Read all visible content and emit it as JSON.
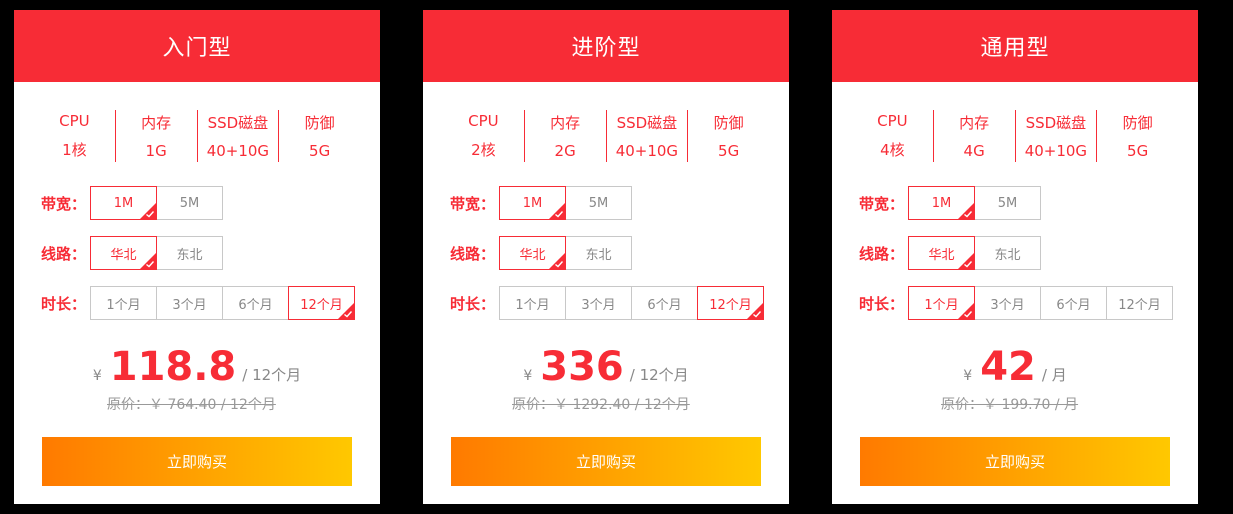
{
  "theme": {
    "accent": "#f72c36",
    "gradient_start": "#ff7a00",
    "gradient_end": "#ffc800"
  },
  "labels": {
    "bandwidth": "带宽：",
    "route": "线路：",
    "duration": "时长："
  },
  "plans": [
    {
      "title": "入门型",
      "specs": [
        {
          "name": "CPU",
          "value": "1核"
        },
        {
          "name": "内存",
          "value": "1G"
        },
        {
          "name": "SSD磁盘",
          "value": "40+10G"
        },
        {
          "name": "防御",
          "value": "5G"
        }
      ],
      "bandwidth": [
        {
          "label": "1M",
          "selected": true
        },
        {
          "label": "5M",
          "selected": false
        }
      ],
      "route": [
        {
          "label": "华北",
          "selected": true
        },
        {
          "label": "东北",
          "selected": false
        }
      ],
      "duration": [
        {
          "label": "1个月",
          "selected": false
        },
        {
          "label": "3个月",
          "selected": false
        },
        {
          "label": "6个月",
          "selected": false
        },
        {
          "label": "12个月",
          "selected": true
        }
      ],
      "currency": "¥",
      "price": "118.8",
      "period": "/ 12个月",
      "original": "原价：￥ 764.40 / 12个月",
      "buy_label": "立即购买"
    },
    {
      "title": "进阶型",
      "specs": [
        {
          "name": "CPU",
          "value": "2核"
        },
        {
          "name": "内存",
          "value": "2G"
        },
        {
          "name": "SSD磁盘",
          "value": "40+10G"
        },
        {
          "name": "防御",
          "value": "5G"
        }
      ],
      "bandwidth": [
        {
          "label": "1M",
          "selected": true
        },
        {
          "label": "5M",
          "selected": false
        }
      ],
      "route": [
        {
          "label": "华北",
          "selected": true
        },
        {
          "label": "东北",
          "selected": false
        }
      ],
      "duration": [
        {
          "label": "1个月",
          "selected": false
        },
        {
          "label": "3个月",
          "selected": false
        },
        {
          "label": "6个月",
          "selected": false
        },
        {
          "label": "12个月",
          "selected": true
        }
      ],
      "currency": "¥",
      "price": "336",
      "period": "/ 12个月",
      "original": "原价：￥ 1292.40 / 12个月",
      "buy_label": "立即购买"
    },
    {
      "title": "通用型",
      "specs": [
        {
          "name": "CPU",
          "value": "4核"
        },
        {
          "name": "内存",
          "value": "4G"
        },
        {
          "name": "SSD磁盘",
          "value": "40+10G"
        },
        {
          "name": "防御",
          "value": "5G"
        }
      ],
      "bandwidth": [
        {
          "label": "1M",
          "selected": true
        },
        {
          "label": "5M",
          "selected": false
        }
      ],
      "route": [
        {
          "label": "华北",
          "selected": true
        },
        {
          "label": "东北",
          "selected": false
        }
      ],
      "duration": [
        {
          "label": "1个月",
          "selected": true
        },
        {
          "label": "3个月",
          "selected": false
        },
        {
          "label": "6个月",
          "selected": false
        },
        {
          "label": "12个月",
          "selected": false
        }
      ],
      "currency": "¥",
      "price": "42",
      "period": "/ 月",
      "original": "原价：￥ 199.70 / 月",
      "buy_label": "立即购买"
    }
  ]
}
